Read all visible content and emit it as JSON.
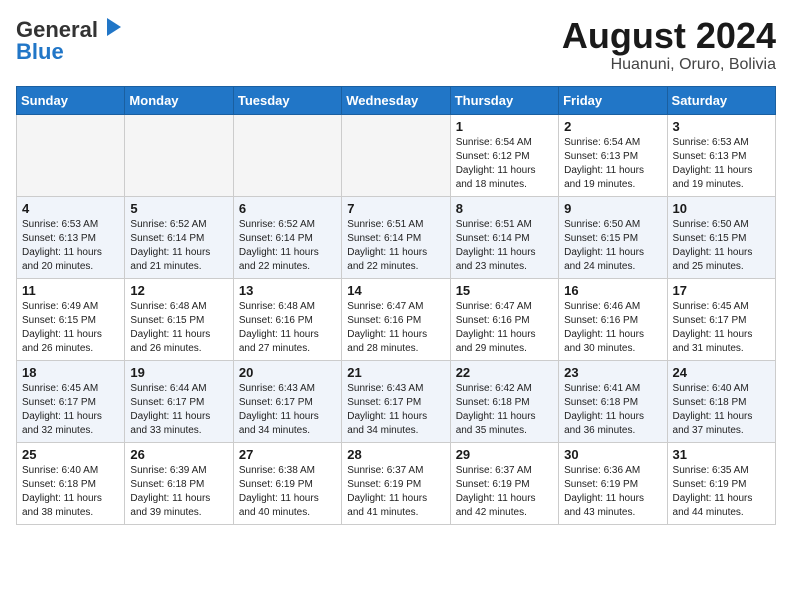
{
  "header": {
    "logo_general": "General",
    "logo_blue": "Blue",
    "month_year": "August 2024",
    "location": "Huanuni, Oruro, Bolivia"
  },
  "days_of_week": [
    "Sunday",
    "Monday",
    "Tuesday",
    "Wednesday",
    "Thursday",
    "Friday",
    "Saturday"
  ],
  "weeks": [
    [
      {
        "day": "",
        "info": ""
      },
      {
        "day": "",
        "info": ""
      },
      {
        "day": "",
        "info": ""
      },
      {
        "day": "",
        "info": ""
      },
      {
        "day": "1",
        "info": "Sunrise: 6:54 AM\nSunset: 6:12 PM\nDaylight: 11 hours\nand 18 minutes."
      },
      {
        "day": "2",
        "info": "Sunrise: 6:54 AM\nSunset: 6:13 PM\nDaylight: 11 hours\nand 19 minutes."
      },
      {
        "day": "3",
        "info": "Sunrise: 6:53 AM\nSunset: 6:13 PM\nDaylight: 11 hours\nand 19 minutes."
      }
    ],
    [
      {
        "day": "4",
        "info": "Sunrise: 6:53 AM\nSunset: 6:13 PM\nDaylight: 11 hours\nand 20 minutes."
      },
      {
        "day": "5",
        "info": "Sunrise: 6:52 AM\nSunset: 6:14 PM\nDaylight: 11 hours\nand 21 minutes."
      },
      {
        "day": "6",
        "info": "Sunrise: 6:52 AM\nSunset: 6:14 PM\nDaylight: 11 hours\nand 22 minutes."
      },
      {
        "day": "7",
        "info": "Sunrise: 6:51 AM\nSunset: 6:14 PM\nDaylight: 11 hours\nand 22 minutes."
      },
      {
        "day": "8",
        "info": "Sunrise: 6:51 AM\nSunset: 6:14 PM\nDaylight: 11 hours\nand 23 minutes."
      },
      {
        "day": "9",
        "info": "Sunrise: 6:50 AM\nSunset: 6:15 PM\nDaylight: 11 hours\nand 24 minutes."
      },
      {
        "day": "10",
        "info": "Sunrise: 6:50 AM\nSunset: 6:15 PM\nDaylight: 11 hours\nand 25 minutes."
      }
    ],
    [
      {
        "day": "11",
        "info": "Sunrise: 6:49 AM\nSunset: 6:15 PM\nDaylight: 11 hours\nand 26 minutes."
      },
      {
        "day": "12",
        "info": "Sunrise: 6:48 AM\nSunset: 6:15 PM\nDaylight: 11 hours\nand 26 minutes."
      },
      {
        "day": "13",
        "info": "Sunrise: 6:48 AM\nSunset: 6:16 PM\nDaylight: 11 hours\nand 27 minutes."
      },
      {
        "day": "14",
        "info": "Sunrise: 6:47 AM\nSunset: 6:16 PM\nDaylight: 11 hours\nand 28 minutes."
      },
      {
        "day": "15",
        "info": "Sunrise: 6:47 AM\nSunset: 6:16 PM\nDaylight: 11 hours\nand 29 minutes."
      },
      {
        "day": "16",
        "info": "Sunrise: 6:46 AM\nSunset: 6:16 PM\nDaylight: 11 hours\nand 30 minutes."
      },
      {
        "day": "17",
        "info": "Sunrise: 6:45 AM\nSunset: 6:17 PM\nDaylight: 11 hours\nand 31 minutes."
      }
    ],
    [
      {
        "day": "18",
        "info": "Sunrise: 6:45 AM\nSunset: 6:17 PM\nDaylight: 11 hours\nand 32 minutes."
      },
      {
        "day": "19",
        "info": "Sunrise: 6:44 AM\nSunset: 6:17 PM\nDaylight: 11 hours\nand 33 minutes."
      },
      {
        "day": "20",
        "info": "Sunrise: 6:43 AM\nSunset: 6:17 PM\nDaylight: 11 hours\nand 34 minutes."
      },
      {
        "day": "21",
        "info": "Sunrise: 6:43 AM\nSunset: 6:17 PM\nDaylight: 11 hours\nand 34 minutes."
      },
      {
        "day": "22",
        "info": "Sunrise: 6:42 AM\nSunset: 6:18 PM\nDaylight: 11 hours\nand 35 minutes."
      },
      {
        "day": "23",
        "info": "Sunrise: 6:41 AM\nSunset: 6:18 PM\nDaylight: 11 hours\nand 36 minutes."
      },
      {
        "day": "24",
        "info": "Sunrise: 6:40 AM\nSunset: 6:18 PM\nDaylight: 11 hours\nand 37 minutes."
      }
    ],
    [
      {
        "day": "25",
        "info": "Sunrise: 6:40 AM\nSunset: 6:18 PM\nDaylight: 11 hours\nand 38 minutes."
      },
      {
        "day": "26",
        "info": "Sunrise: 6:39 AM\nSunset: 6:18 PM\nDaylight: 11 hours\nand 39 minutes."
      },
      {
        "day": "27",
        "info": "Sunrise: 6:38 AM\nSunset: 6:19 PM\nDaylight: 11 hours\nand 40 minutes."
      },
      {
        "day": "28",
        "info": "Sunrise: 6:37 AM\nSunset: 6:19 PM\nDaylight: 11 hours\nand 41 minutes."
      },
      {
        "day": "29",
        "info": "Sunrise: 6:37 AM\nSunset: 6:19 PM\nDaylight: 11 hours\nand 42 minutes."
      },
      {
        "day": "30",
        "info": "Sunrise: 6:36 AM\nSunset: 6:19 PM\nDaylight: 11 hours\nand 43 minutes."
      },
      {
        "day": "31",
        "info": "Sunrise: 6:35 AM\nSunset: 6:19 PM\nDaylight: 11 hours\nand 44 minutes."
      }
    ]
  ]
}
